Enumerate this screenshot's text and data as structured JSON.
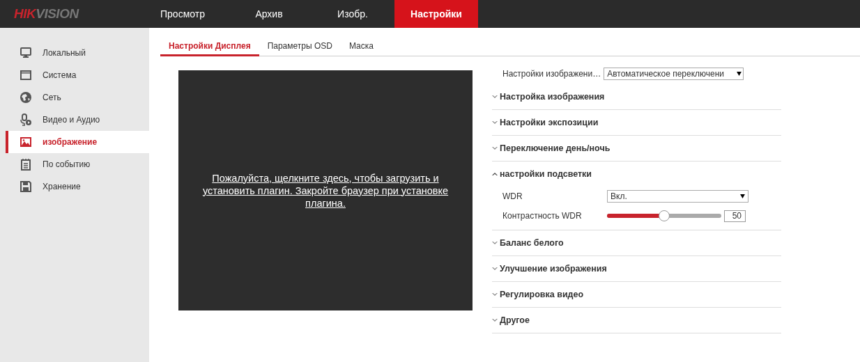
{
  "header": {
    "logo": [
      "HIK",
      "VISION"
    ],
    "nav": [
      {
        "label": "Просмотр",
        "selected": false
      },
      {
        "label": "Архив",
        "selected": false
      },
      {
        "label": "Изобр.",
        "selected": false
      },
      {
        "label": "Настройки",
        "selected": true
      }
    ]
  },
  "sidebar": {
    "items": [
      {
        "label": "Локальный",
        "selected": false
      },
      {
        "label": "Система",
        "selected": false
      },
      {
        "label": "Сеть",
        "selected": false
      },
      {
        "label": "Видео и Аудио",
        "selected": false
      },
      {
        "label": "изображение",
        "selected": true
      },
      {
        "label": "По событию",
        "selected": false
      },
      {
        "label": "Хранение",
        "selected": false
      }
    ]
  },
  "tabs": [
    {
      "label": "Настройки Дисплея",
      "selected": true
    },
    {
      "label": "Параметры OSD",
      "selected": false
    },
    {
      "label": "Маска",
      "selected": false
    }
  ],
  "video": {
    "message": "Пожалуйста, щелкните здесь, чтобы загрузить и установить плагин. Закройте браузер при установке плагина."
  },
  "mode": {
    "label": "Настройки изображени…",
    "value": "Автоматическое переключени"
  },
  "sections": [
    {
      "title": "Настройка изображения",
      "expanded": false
    },
    {
      "title": "Настройки экспозиции",
      "expanded": false
    },
    {
      "title": "Переключение день/ночь",
      "expanded": false
    },
    {
      "title": "настройки подсветки",
      "expanded": true,
      "rows": [
        {
          "kind": "select",
          "label": "WDR",
          "value": "Вкл."
        },
        {
          "kind": "slider",
          "label": "Контрастность WDR",
          "level": 0.5,
          "value": "50"
        }
      ]
    },
    {
      "title": "Баланс белого",
      "expanded": false
    },
    {
      "title": "Улучшение изображения",
      "expanded": false
    },
    {
      "title": "Регулировка видео",
      "expanded": false
    },
    {
      "title": "Другое",
      "expanded": false
    }
  ]
}
